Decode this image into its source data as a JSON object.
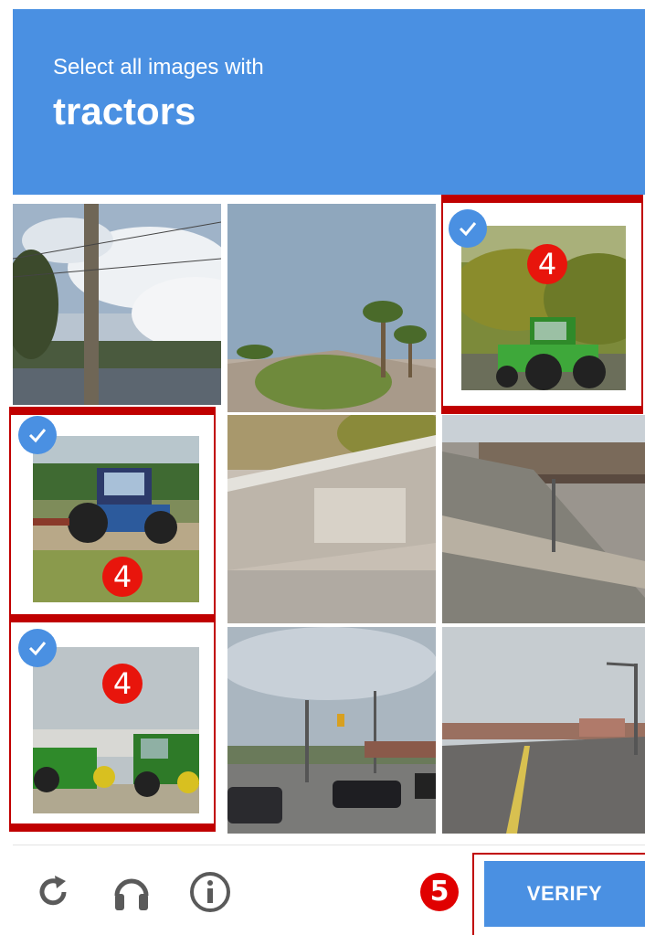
{
  "header": {
    "prompt": "Select all images with",
    "target": "tractors"
  },
  "tiles": [
    {
      "row": 1,
      "col": 1,
      "scene": "utility pole and clouds",
      "selected": false
    },
    {
      "row": 1,
      "col": 2,
      "scene": "palm trees and bush",
      "selected": false
    },
    {
      "row": 1,
      "col": 3,
      "scene": "green tractor",
      "selected": true,
      "marker": "4"
    },
    {
      "row": 2,
      "col": 1,
      "scene": "blue tractor on field",
      "selected": true,
      "marker": "4"
    },
    {
      "row": 2,
      "col": 2,
      "scene": "concrete wall and railing",
      "selected": false
    },
    {
      "row": 2,
      "col": 3,
      "scene": "road overpass",
      "selected": false
    },
    {
      "row": 3,
      "col": 1,
      "scene": "tractors in yard",
      "selected": true,
      "marker": "4"
    },
    {
      "row": 3,
      "col": 2,
      "scene": "street with cars",
      "selected": false
    },
    {
      "row": 3,
      "col": 3,
      "scene": "road with street light",
      "selected": false
    }
  ],
  "footer": {
    "icons": [
      "reload-icon",
      "headphones-icon",
      "info-icon"
    ],
    "step_marker": "5",
    "verify_label": "VERIFY"
  },
  "colors": {
    "accent": "#4a90e2",
    "highlight": "#c00000",
    "marker": "#e8150c"
  }
}
